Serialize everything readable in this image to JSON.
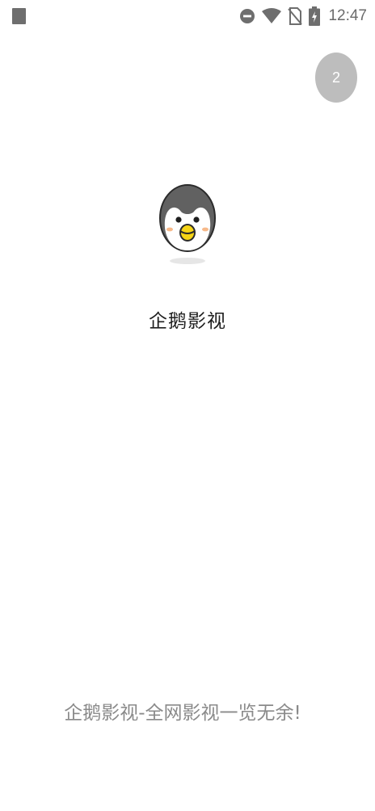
{
  "status_bar": {
    "time": "12:47",
    "icons": [
      "notification-icon",
      "do-not-disturb-icon",
      "wifi-icon",
      "no-sim-icon",
      "battery-charging-icon"
    ]
  },
  "splash": {
    "skip_countdown": "2",
    "app_name": "企鹅影视",
    "slogan": "企鹅影视-全网影视一览无余!"
  },
  "colors": {
    "background": "#ffffff",
    "skip_button": "#bdbdbd",
    "logo_head": "#616161",
    "logo_beak": "#f5d416",
    "text_primary": "#1e1e1e",
    "text_secondary": "#8a8a8a"
  }
}
